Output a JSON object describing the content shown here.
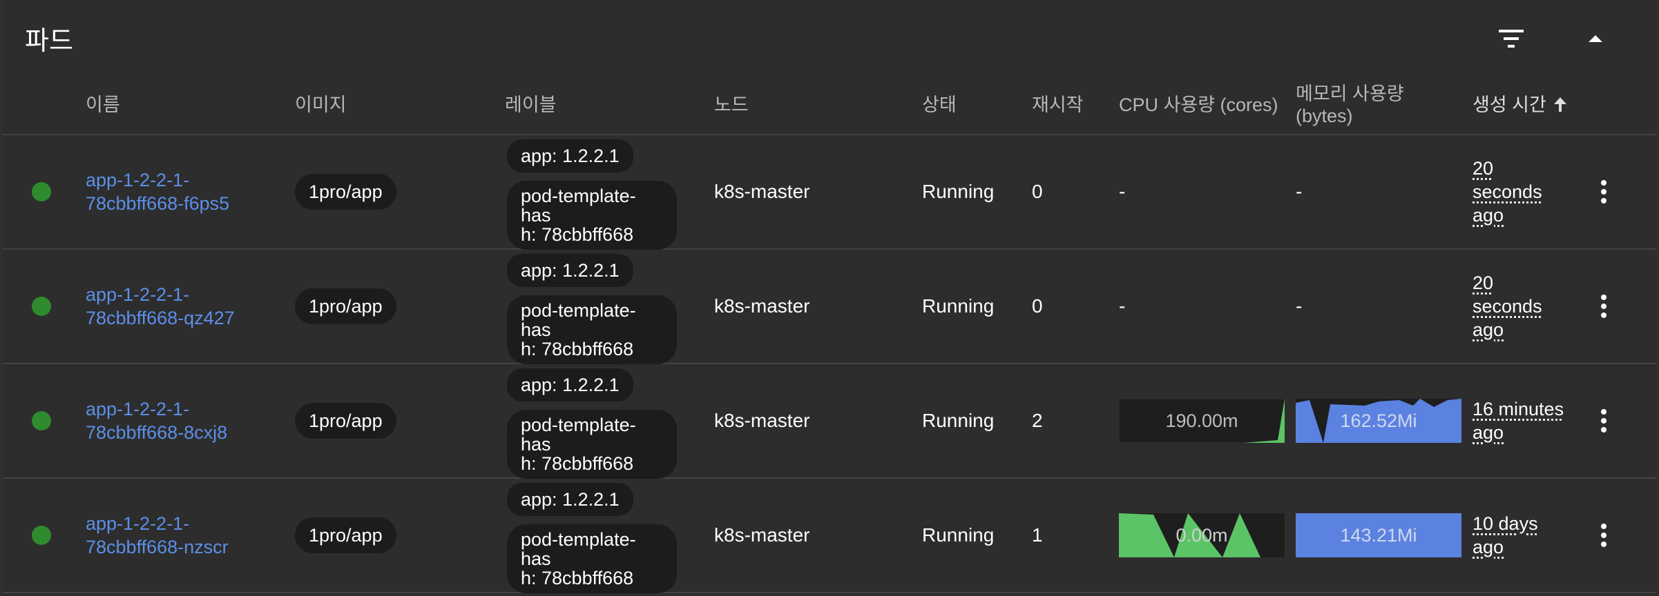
{
  "card": {
    "title": "파드"
  },
  "columns": {
    "name": "이름",
    "image": "이미지",
    "labels": "레이블",
    "node": "노드",
    "status": "상태",
    "restarts": "재시작",
    "cpu": "CPU 사용량 (cores)",
    "memory_line1": "메모리 사용량",
    "memory_line2": "(bytes)",
    "created": "생성 시간"
  },
  "rows": [
    {
      "name_line1": "app-1-2-2-1-",
      "name_line2": "78cbbff668-f6ps5",
      "image": "1pro/app",
      "label_app": "app: 1.2.2.1",
      "label_hash_line1": "pod-template-has",
      "label_hash_line2": "h: 78cbbff668",
      "node": "k8s-master",
      "status": "Running",
      "restarts": "0",
      "cpu": "-",
      "memory": "-",
      "age_line1": "20",
      "age_line2": "seconds",
      "age_line3": "ago"
    },
    {
      "name_line1": "app-1-2-2-1-",
      "name_line2": "78cbbff668-qz427",
      "image": "1pro/app",
      "label_app": "app: 1.2.2.1",
      "label_hash_line1": "pod-template-has",
      "label_hash_line2": "h: 78cbbff668",
      "node": "k8s-master",
      "status": "Running",
      "restarts": "0",
      "cpu": "-",
      "memory": "-",
      "age_line1": "20",
      "age_line2": "seconds",
      "age_line3": "ago"
    },
    {
      "name_line1": "app-1-2-2-1-",
      "name_line2": "78cbbff668-8cxj8",
      "image": "1pro/app",
      "label_app": "app: 1.2.2.1",
      "label_hash_line1": "pod-template-has",
      "label_hash_line2": "h: 78cbbff668",
      "node": "k8s-master",
      "status": "Running",
      "restarts": "2",
      "cpu": "190.00m",
      "memory": "162.52Mi",
      "age_line1": "16 minutes",
      "age_line2": "ago"
    },
    {
      "name_line1": "app-1-2-2-1-",
      "name_line2": "78cbbff668-nzscr",
      "image": "1pro/app",
      "label_app": "app: 1.2.2.1",
      "label_hash_line1": "pod-template-has",
      "label_hash_line2": "h: 78cbbff668",
      "node": "k8s-master",
      "status": "Running",
      "restarts": "1",
      "cpu": "0.00m",
      "memory": "143.21Mi",
      "age_line1": "10 days",
      "age_line2": "ago"
    }
  ],
  "colors": {
    "status_running": "#2e8b2e",
    "link": "#5c8fe8",
    "cpu_spark": "#5bc466",
    "memory_spark": "#5b82e0"
  },
  "icons": {
    "filter": "filter-icon",
    "collapse": "chevron-up-icon",
    "sort": "arrow-up-icon",
    "row_menu": "more-vert-icon",
    "status": "status-dot-icon"
  }
}
